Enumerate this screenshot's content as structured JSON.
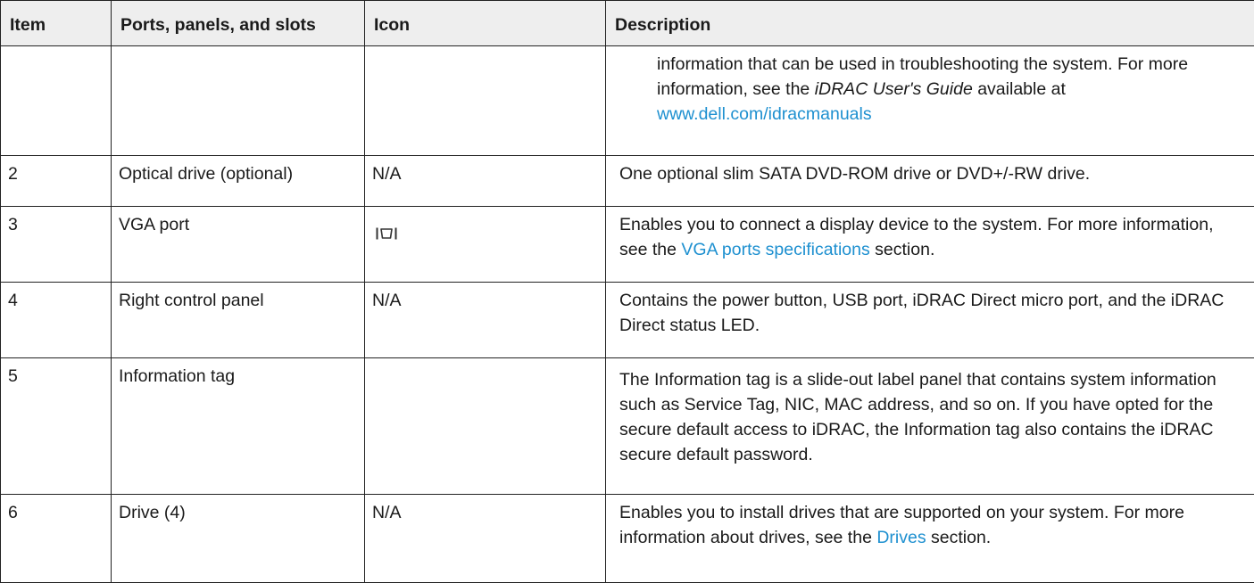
{
  "headers": {
    "item": "Item",
    "ports": "Ports, panels, and slots",
    "icon": "Icon",
    "description": "Description"
  },
  "continuation": {
    "text_before": "information that can be used in troubleshooting the system. For more information, see the ",
    "guide": "iDRAC User's Guide",
    "text_mid": " available at ",
    "link": "www.dell.com/idracmanuals"
  },
  "rows": [
    {
      "item": "2",
      "port": "Optical drive (optional)",
      "icon": "N/A",
      "desc": "One optional slim SATA DVD-ROM drive or DVD+/-RW drive."
    },
    {
      "item": "3",
      "port": "VGA port",
      "icon_name": "vga-port-icon",
      "desc_before": "Enables you to connect a display device to the system. For more information, see the ",
      "desc_link": "VGA ports specifications",
      "desc_after": " section."
    },
    {
      "item": "4",
      "port": "Right control panel",
      "icon": "N/A",
      "desc": "Contains the power button, USB port, iDRAC Direct micro port, and the iDRAC Direct status LED."
    },
    {
      "item": "5",
      "port": "Information tag",
      "icon": "",
      "desc": "The Information tag is a slide-out label panel that contains system information such as Service Tag, NIC, MAC address, and so on. If you have opted for the secure default access to iDRAC, the Information tag also contains the iDRAC secure default password."
    },
    {
      "item": "6",
      "port": "Drive (4)",
      "icon": "N/A",
      "desc_before": "Enables you to install drives that are supported on your system. For more information about drives, see the ",
      "desc_link": "Drives",
      "desc_after": " section."
    }
  ]
}
